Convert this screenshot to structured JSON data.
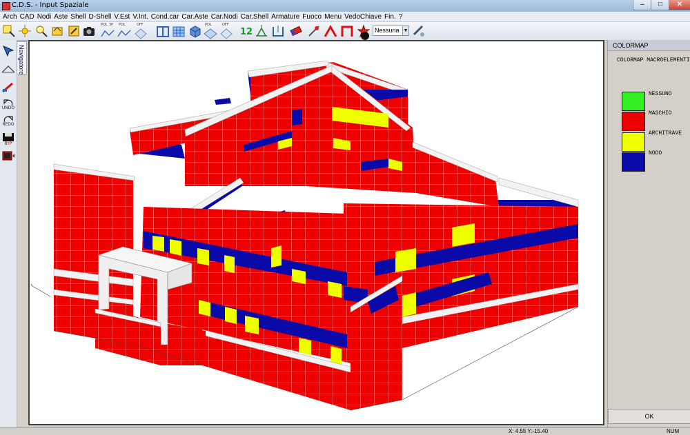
{
  "window": {
    "title": "C.D.S. - Input Spaziale",
    "controls": [
      "minimize",
      "maximize",
      "close"
    ]
  },
  "menu": [
    "Arch",
    "CAD",
    "Nodi",
    "Aste",
    "Shell",
    "D-Shell",
    "V.Est",
    "V.Int.",
    "Cond.car",
    "Car.Aste",
    "Car.Nodi",
    "Car.Shell",
    "Armature",
    "Fuoco",
    "Menu",
    "VedoChiave",
    "Fin.",
    "?"
  ],
  "toolbar": {
    "icon_labels": [
      "POL",
      "3P",
      "POL",
      "OFF",
      "POL",
      "OFF"
    ],
    "select_value": "Nessuna"
  },
  "left_tools": {
    "undo_label": "UNDO",
    "redo_label": "REDO",
    "save_label": "BYP"
  },
  "navigator": {
    "label": "Navigatore"
  },
  "colormap": {
    "panel_title": "COLORMAP",
    "heading": "COLORMAP MACROELEMENTI",
    "entries": [
      {
        "label": "NESSUNO",
        "color": "#33ee22"
      },
      {
        "label": "MASCHIO",
        "color": "#ee0000"
      },
      {
        "label": "ARCHITRAVE",
        "color": "#eeff00"
      },
      {
        "label": "NODO",
        "color": "#0a0aa8"
      }
    ],
    "ok_label": "OK"
  },
  "status": {
    "coords": "X:  4.55   Y:-15.40",
    "num": "NUM"
  },
  "colors": {
    "wall": "#ee0000",
    "lintel": "#eeff00",
    "node": "#0a0aa8",
    "beam": "#f2f2f2"
  }
}
